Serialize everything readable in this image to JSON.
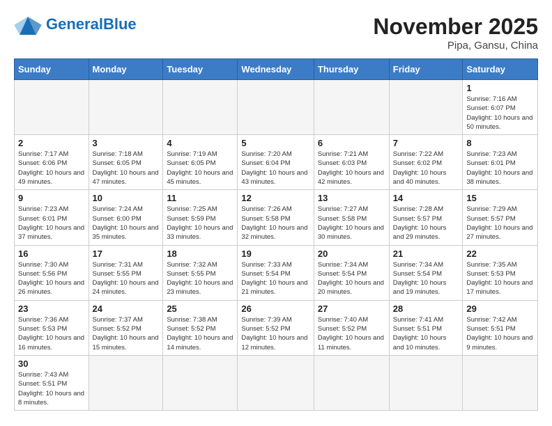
{
  "header": {
    "logo_general": "General",
    "logo_blue": "Blue",
    "month_year": "November 2025",
    "location": "Pipa, Gansu, China"
  },
  "days_of_week": [
    "Sunday",
    "Monday",
    "Tuesday",
    "Wednesday",
    "Thursday",
    "Friday",
    "Saturday"
  ],
  "weeks": [
    [
      {
        "day": "",
        "info": "",
        "empty": true
      },
      {
        "day": "",
        "info": "",
        "empty": true
      },
      {
        "day": "",
        "info": "",
        "empty": true
      },
      {
        "day": "",
        "info": "",
        "empty": true
      },
      {
        "day": "",
        "info": "",
        "empty": true
      },
      {
        "day": "",
        "info": "",
        "empty": true
      },
      {
        "day": "1",
        "info": "Sunrise: 7:16 AM\nSunset: 6:07 PM\nDaylight: 10 hours and 50 minutes."
      }
    ],
    [
      {
        "day": "2",
        "info": "Sunrise: 7:17 AM\nSunset: 6:06 PM\nDaylight: 10 hours and 49 minutes."
      },
      {
        "day": "3",
        "info": "Sunrise: 7:18 AM\nSunset: 6:05 PM\nDaylight: 10 hours and 47 minutes."
      },
      {
        "day": "4",
        "info": "Sunrise: 7:19 AM\nSunset: 6:05 PM\nDaylight: 10 hours and 45 minutes."
      },
      {
        "day": "5",
        "info": "Sunrise: 7:20 AM\nSunset: 6:04 PM\nDaylight: 10 hours and 43 minutes."
      },
      {
        "day": "6",
        "info": "Sunrise: 7:21 AM\nSunset: 6:03 PM\nDaylight: 10 hours and 42 minutes."
      },
      {
        "day": "7",
        "info": "Sunrise: 7:22 AM\nSunset: 6:02 PM\nDaylight: 10 hours and 40 minutes."
      },
      {
        "day": "8",
        "info": "Sunrise: 7:23 AM\nSunset: 6:01 PM\nDaylight: 10 hours and 38 minutes."
      }
    ],
    [
      {
        "day": "9",
        "info": "Sunrise: 7:23 AM\nSunset: 6:01 PM\nDaylight: 10 hours and 37 minutes."
      },
      {
        "day": "10",
        "info": "Sunrise: 7:24 AM\nSunset: 6:00 PM\nDaylight: 10 hours and 35 minutes."
      },
      {
        "day": "11",
        "info": "Sunrise: 7:25 AM\nSunset: 5:59 PM\nDaylight: 10 hours and 33 minutes."
      },
      {
        "day": "12",
        "info": "Sunrise: 7:26 AM\nSunset: 5:58 PM\nDaylight: 10 hours and 32 minutes."
      },
      {
        "day": "13",
        "info": "Sunrise: 7:27 AM\nSunset: 5:58 PM\nDaylight: 10 hours and 30 minutes."
      },
      {
        "day": "14",
        "info": "Sunrise: 7:28 AM\nSunset: 5:57 PM\nDaylight: 10 hours and 29 minutes."
      },
      {
        "day": "15",
        "info": "Sunrise: 7:29 AM\nSunset: 5:57 PM\nDaylight: 10 hours and 27 minutes."
      }
    ],
    [
      {
        "day": "16",
        "info": "Sunrise: 7:30 AM\nSunset: 5:56 PM\nDaylight: 10 hours and 26 minutes."
      },
      {
        "day": "17",
        "info": "Sunrise: 7:31 AM\nSunset: 5:55 PM\nDaylight: 10 hours and 24 minutes."
      },
      {
        "day": "18",
        "info": "Sunrise: 7:32 AM\nSunset: 5:55 PM\nDaylight: 10 hours and 23 minutes."
      },
      {
        "day": "19",
        "info": "Sunrise: 7:33 AM\nSunset: 5:54 PM\nDaylight: 10 hours and 21 minutes."
      },
      {
        "day": "20",
        "info": "Sunrise: 7:34 AM\nSunset: 5:54 PM\nDaylight: 10 hours and 20 minutes."
      },
      {
        "day": "21",
        "info": "Sunrise: 7:34 AM\nSunset: 5:54 PM\nDaylight: 10 hours and 19 minutes."
      },
      {
        "day": "22",
        "info": "Sunrise: 7:35 AM\nSunset: 5:53 PM\nDaylight: 10 hours and 17 minutes."
      }
    ],
    [
      {
        "day": "23",
        "info": "Sunrise: 7:36 AM\nSunset: 5:53 PM\nDaylight: 10 hours and 16 minutes."
      },
      {
        "day": "24",
        "info": "Sunrise: 7:37 AM\nSunset: 5:52 PM\nDaylight: 10 hours and 15 minutes."
      },
      {
        "day": "25",
        "info": "Sunrise: 7:38 AM\nSunset: 5:52 PM\nDaylight: 10 hours and 14 minutes."
      },
      {
        "day": "26",
        "info": "Sunrise: 7:39 AM\nSunset: 5:52 PM\nDaylight: 10 hours and 12 minutes."
      },
      {
        "day": "27",
        "info": "Sunrise: 7:40 AM\nSunset: 5:52 PM\nDaylight: 10 hours and 11 minutes."
      },
      {
        "day": "28",
        "info": "Sunrise: 7:41 AM\nSunset: 5:51 PM\nDaylight: 10 hours and 10 minutes."
      },
      {
        "day": "29",
        "info": "Sunrise: 7:42 AM\nSunset: 5:51 PM\nDaylight: 10 hours and 9 minutes."
      }
    ],
    [
      {
        "day": "30",
        "info": "Sunrise: 7:43 AM\nSunset: 5:51 PM\nDaylight: 10 hours and 8 minutes."
      },
      {
        "day": "",
        "info": "",
        "empty": true
      },
      {
        "day": "",
        "info": "",
        "empty": true
      },
      {
        "day": "",
        "info": "",
        "empty": true
      },
      {
        "day": "",
        "info": "",
        "empty": true
      },
      {
        "day": "",
        "info": "",
        "empty": true
      },
      {
        "day": "",
        "info": "",
        "empty": true
      }
    ]
  ]
}
